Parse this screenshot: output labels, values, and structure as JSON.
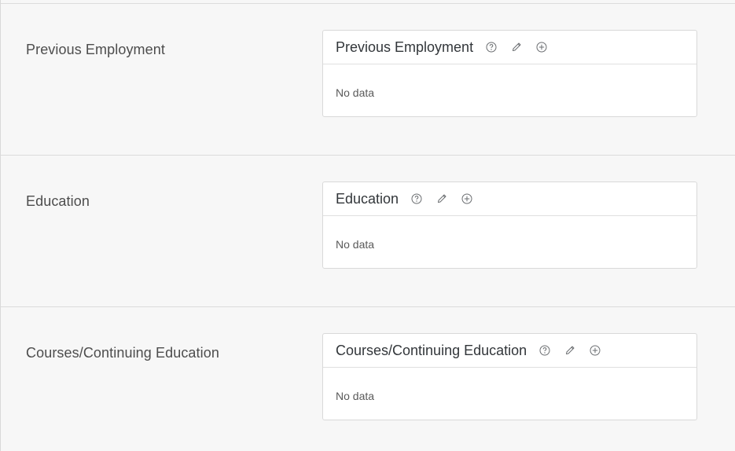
{
  "sections": [
    {
      "label": "Previous Employment",
      "card_title": "Previous Employment",
      "body_text": "No data",
      "icons": [
        "help-icon",
        "edit-icon",
        "add-icon"
      ]
    },
    {
      "label": "Education",
      "card_title": "Education",
      "body_text": "No data",
      "icons": [
        "help-icon",
        "edit-icon",
        "add-icon"
      ]
    },
    {
      "label": "Courses/Continuing Education",
      "card_title": "Courses/Continuing Education",
      "body_text": "No data",
      "icons": [
        "help-icon",
        "edit-icon",
        "add-icon"
      ]
    }
  ],
  "colors": {
    "background": "#f7f7f7",
    "card_background": "#ffffff",
    "border": "#d9d9d9",
    "icon": "#6a6d70",
    "title_text": "#32363a"
  }
}
